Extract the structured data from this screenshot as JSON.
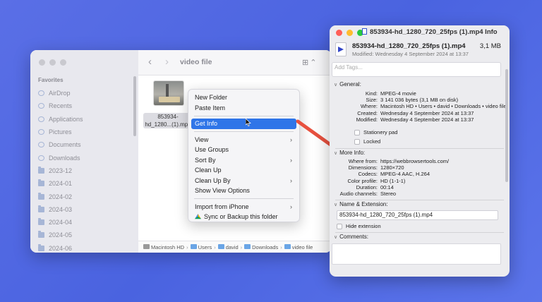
{
  "finder": {
    "title": "video file",
    "sidebar": {
      "heading": "Favorites",
      "items": [
        {
          "label": "AirDrop",
          "icon": "airdrop-icon"
        },
        {
          "label": "Recents",
          "icon": "clock-icon"
        },
        {
          "label": "Applications",
          "icon": "applications-icon"
        },
        {
          "label": "Pictures",
          "icon": "pictures-icon"
        },
        {
          "label": "Documents",
          "icon": "document-icon"
        },
        {
          "label": "Downloads",
          "icon": "downloads-icon"
        },
        {
          "label": "2023-12",
          "icon": "folder-icon"
        },
        {
          "label": "2024-01",
          "icon": "folder-icon"
        },
        {
          "label": "2024-02",
          "icon": "folder-icon"
        },
        {
          "label": "2024-03",
          "icon": "folder-icon"
        },
        {
          "label": "2024-04",
          "icon": "folder-icon"
        },
        {
          "label": "2024-05",
          "icon": "folder-icon"
        },
        {
          "label": "2024-06",
          "icon": "folder-icon"
        }
      ]
    },
    "file": {
      "label_line1": "853934-",
      "label_line2": "hd_1280...(1).mp4"
    },
    "pathbar": [
      "Macintosh HD",
      "Users",
      "david",
      "Downloads",
      "video file"
    ]
  },
  "context_menu": {
    "items": [
      {
        "label": "New Folder"
      },
      {
        "label": "Paste Item"
      },
      {
        "sep": true
      },
      {
        "label": "Get Info",
        "highlighted": true
      },
      {
        "sep": true
      },
      {
        "label": "View",
        "submenu": true
      },
      {
        "label": "Use Groups"
      },
      {
        "label": "Sort By",
        "submenu": true
      },
      {
        "label": "Clean Up"
      },
      {
        "label": "Clean Up By",
        "submenu": true
      },
      {
        "label": "Show View Options"
      },
      {
        "sep": true
      },
      {
        "label": "Import from iPhone",
        "submenu": true
      },
      {
        "label": "Sync or Backup this folder",
        "icon": "google-drive-icon"
      }
    ]
  },
  "info": {
    "window_title": "853934-hd_1280_720_25fps (1).mp4 Info",
    "name": "853934-hd_1280_720_25fps (1).mp4",
    "size": "3,1 MB",
    "modified": "Modified: Wednesday 4 September 2024 at 13:37",
    "tags_placeholder": "Add Tags...",
    "general": {
      "heading": "General:",
      "rows": [
        {
          "k": "Kind:",
          "v": "MPEG-4 movie"
        },
        {
          "k": "Size:",
          "v": "3 141 036 bytes (3,1 MB on disk)"
        },
        {
          "k": "Where:",
          "v": "Macintosh HD • Users • david • Downloads • video file"
        },
        {
          "k": "Created:",
          "v": "Wednesday 4 September 2024 at 13:37"
        },
        {
          "k": "Modified:",
          "v": "Wednesday 4 September 2024 at 13:37"
        }
      ],
      "stationery": "Stationery pad",
      "locked": "Locked"
    },
    "more_info": {
      "heading": "More Info:",
      "rows": [
        {
          "k": "Where from:",
          "v": "https://webbrowsertools.com/"
        },
        {
          "k": "Dimensions:",
          "v": "1280×720"
        },
        {
          "k": "Codecs:",
          "v": "MPEG-4 AAC, H.264"
        },
        {
          "k": "Color profile:",
          "v": "HD (1-1-1)"
        },
        {
          "k": "Duration:",
          "v": "00:14"
        },
        {
          "k": "Audio channels:",
          "v": "Stereo"
        }
      ]
    },
    "name_ext": {
      "heading": "Name & Extension:",
      "value": "853934-hd_1280_720_25fps (1).mp4",
      "hide_extension": "Hide extension"
    },
    "comments": {
      "heading": "Comments:"
    }
  },
  "colors": {
    "accent": "#2f75e8",
    "annotation_arrow": "#e8513f",
    "background": "#4f68e4"
  }
}
